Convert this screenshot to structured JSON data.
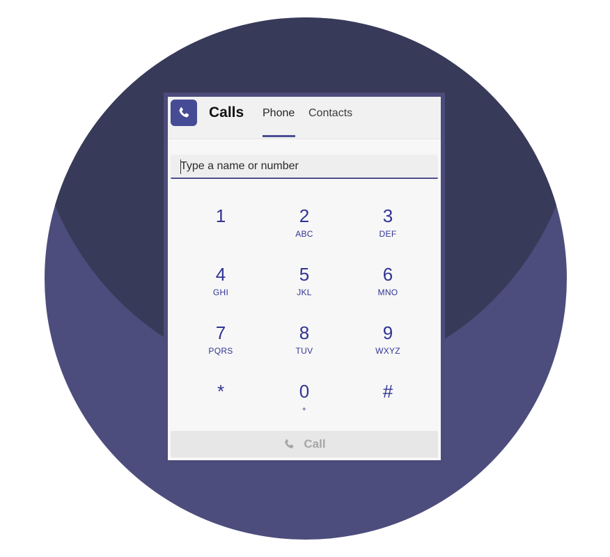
{
  "app": {
    "title": "Calls",
    "icon": "phone-icon",
    "accent": "#454b94"
  },
  "tabs": [
    {
      "label": "Phone",
      "active": true
    },
    {
      "label": "Contacts",
      "active": false
    }
  ],
  "search": {
    "placeholder": "Type a name or number",
    "value": ""
  },
  "keypad": [
    {
      "digit": "1",
      "letters": ""
    },
    {
      "digit": "2",
      "letters": "ABC"
    },
    {
      "digit": "3",
      "letters": "DEF"
    },
    {
      "digit": "4",
      "letters": "GHI"
    },
    {
      "digit": "5",
      "letters": "JKL"
    },
    {
      "digit": "6",
      "letters": "MNO"
    },
    {
      "digit": "7",
      "letters": "PQRS"
    },
    {
      "digit": "8",
      "letters": "TUV"
    },
    {
      "digit": "9",
      "letters": "WXYZ"
    },
    {
      "digit": "*",
      "letters": ""
    },
    {
      "digit": "0",
      "letters": "+"
    },
    {
      "digit": "#",
      "letters": ""
    }
  ],
  "call_button": {
    "label": "Call",
    "icon": "phone-icon",
    "enabled": false
  },
  "colors": {
    "digit": "#303494",
    "background_outer": "#4c4d7c",
    "background_inner": "#383a59"
  }
}
